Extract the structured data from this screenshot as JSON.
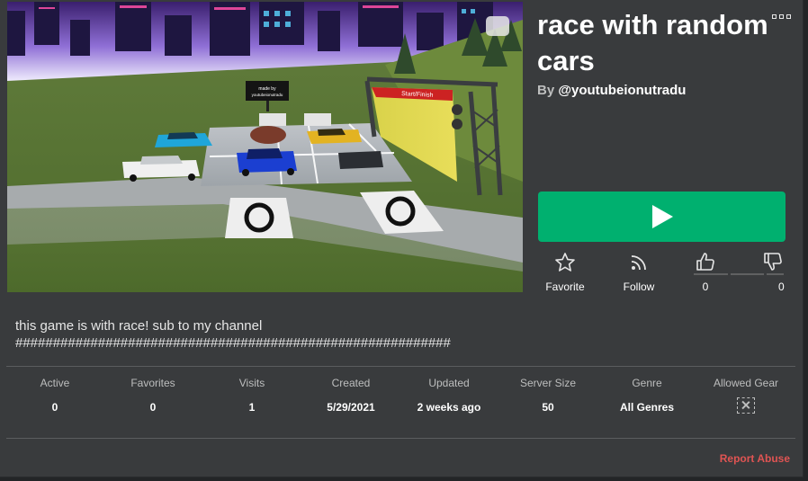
{
  "game": {
    "title": "race with random cars",
    "by_label": "By",
    "creator": "@youtubeionutradu",
    "description_line1": "this game is with race! sub to my channel",
    "description_line2": "##########################################################"
  },
  "thumbnail": {
    "sign_text": "made by youtubeionutradu",
    "banner_text": "Start/Finish"
  },
  "actions": {
    "favorite_label": "Favorite",
    "follow_label": "Follow",
    "upvotes": "0",
    "downvotes": "0"
  },
  "stats": [
    {
      "label": "Active",
      "value": "0"
    },
    {
      "label": "Favorites",
      "value": "0"
    },
    {
      "label": "Visits",
      "value": "1"
    },
    {
      "label": "Created",
      "value": "5/29/2021"
    },
    {
      "label": "Updated",
      "value": "2 weeks ago"
    },
    {
      "label": "Server Size",
      "value": "50"
    },
    {
      "label": "Genre",
      "value": "All Genres"
    },
    {
      "label": "Allowed Gear",
      "value": ""
    }
  ],
  "footer": {
    "report_label": "Report Abuse"
  },
  "colors": {
    "play_button": "#00b06f",
    "panel_bg": "#393b3d",
    "report_link": "#e05453"
  },
  "icons": {
    "play": "play-icon",
    "favorite": "star-icon",
    "follow": "rss-icon",
    "upvote": "thumbs-up-icon",
    "downvote": "thumbs-down-icon",
    "more": "ellipsis-icon",
    "gear": "no-gear-icon"
  }
}
